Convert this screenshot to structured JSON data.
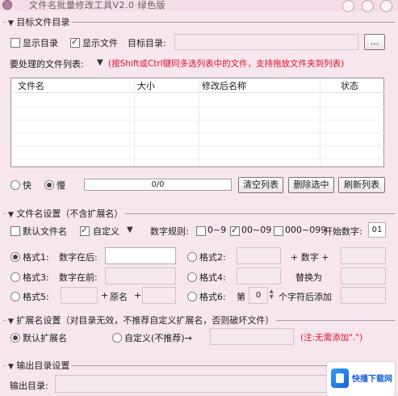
{
  "window": {
    "title": "文件名批量修改工具V2.0  绿色版",
    "buttons": [
      "minimize",
      "maximize",
      "close"
    ]
  },
  "target_dir": {
    "section_title": "目标文件目录",
    "show_dir_label": "显示目录",
    "show_dir_checked": false,
    "show_file_label": "显示文件",
    "show_file_checked": true,
    "dir_label": "目标目录:",
    "dir_value": "",
    "browse_label": "..."
  },
  "file_list": {
    "label": "要处理的文件列表:",
    "hint": "(按Shift或Ctrl键同多选列表中的文件，支持拖放文件夹到列表)",
    "columns": [
      "文件名",
      "大小",
      "修改后名称",
      "状态"
    ],
    "rows": []
  },
  "controls": {
    "speed_fast": "快",
    "speed_slow": "慢",
    "speed_selected": "slow",
    "progress_text": "0/0",
    "progress": 0,
    "clear_list": "清空列表",
    "delete_selected": "删除选中",
    "refresh_list": "刷新列表"
  },
  "name_settings": {
    "section_title": "文件名设置（不含扩展名）",
    "default_name_label": "默认文件名",
    "default_name_checked": false,
    "custom_label": "自定义",
    "custom_checked": true,
    "number_rule_label": "数字规则:",
    "rule_1": "0~9",
    "rule_1_checked": false,
    "rule_2": "00~09",
    "rule_2_checked": true,
    "rule_3": "000~099",
    "rule_3_checked": false,
    "start_number_label": "开始数字:",
    "start_number": "01",
    "format1_label": "格式1:",
    "format1_text": "数字在后:",
    "format2_label": "格式2:",
    "format2_plus": "+ 数字 +",
    "format3_label": "格式3:",
    "format3_text": "数字在前:",
    "format4_label": "格式4:",
    "format4_text": "替换为",
    "format5_label": "格式5:",
    "format5_plus1": "+",
    "format5_text": "原名",
    "format5_plus2": "+",
    "format6_label": "格式6:",
    "format6_prefix": "第",
    "format6_value": "0",
    "format6_suffix": "个字符后添加",
    "selected_format": "格式1"
  },
  "ext_settings": {
    "section_title": "扩展名设置（对目录无效，不推荐自定义扩展名，否则破坏文件）",
    "default_ext_label": "默认扩展名",
    "custom_ext_label": "自定义(不推荐)→",
    "selected": "default",
    "note": "(注:无需添加\".\")"
  },
  "output_dir": {
    "section_title": "输出目录设置",
    "dir_label": "输出目录:",
    "dir_value": ""
  },
  "watermark": {
    "text": "快播下载网"
  }
}
